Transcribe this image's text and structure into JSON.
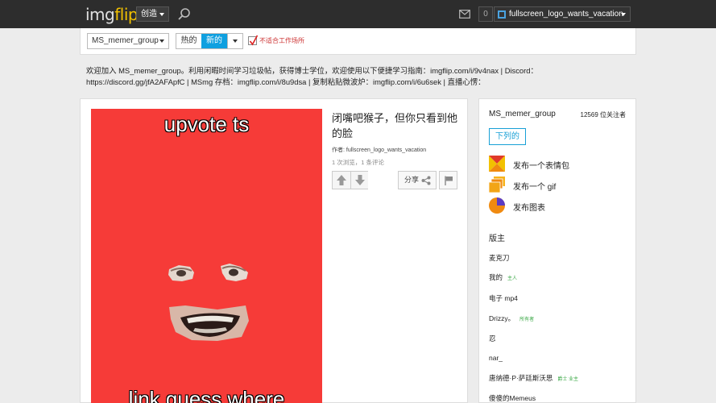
{
  "nav": {
    "logo_img": "img",
    "logo_flip": "flip",
    "create_label": "创造",
    "notification_count": "0",
    "username": "fullscreen_logo_wants_vacation"
  },
  "filter": {
    "stream_select": "MS_memer_group",
    "tab_hot": "热的",
    "tab_new": "新的",
    "nsfw_label": "不适合工作场所"
  },
  "description": {
    "line1": "欢迎加入 MS_memer_group。利用闲暇时间学习垃圾帖，获得博士学位，欢迎使用以下便捷学习指南：imgflip.com/i/9v4nax | Discord：",
    "line2": "https://discord.gg/jfA2AFApfC | MSmg 存档：imgflip.com/i/8u9dsa | 复制粘贴微波炉：imgflip.com/i/6u6sek | 直播心愣："
  },
  "post": {
    "meme_top_text": "upvote ts",
    "meme_bottom_text": "link guess where",
    "title": "闭嘴吧猴子，但你只看到他的脸",
    "author_prefix": "作者:",
    "author": "fullscreen_logo_wants_vacation",
    "stats": "1 次浏览，1 条评论",
    "share_label": "分享"
  },
  "sidebar": {
    "stream_name": "MS_memer_group",
    "followers": "12569 位关注者",
    "follow_label": "下列的",
    "actions": [
      {
        "label": "发布一个表情包",
        "icon": "meme-grid-icon"
      },
      {
        "label": "发布一个 gif",
        "icon": "gif-stack-icon"
      },
      {
        "label": "发布图表",
        "icon": "pie-chart-icon"
      }
    ],
    "mods_heading": "版主",
    "mods": [
      {
        "name": "麦克刀",
        "tag": ""
      },
      {
        "name": "我的",
        "tag": "主人"
      },
      {
        "name": "电子 mp4",
        "tag": ""
      },
      {
        "name": "Drizzy。",
        "tag": "所有者"
      },
      {
        "name": "忍",
        "tag": ""
      },
      {
        "name": "nar_",
        "tag": ""
      },
      {
        "name": "唐纳德·P·萨廷斯沃思",
        "tag": "爵士 业主"
      },
      {
        "name": "傻傻的Memeus",
        "tag": ""
      }
    ]
  },
  "colors": {
    "accent_blue": "#0fa0e0",
    "logo_yellow": "#f2c100",
    "meme_red": "#f63b38"
  }
}
